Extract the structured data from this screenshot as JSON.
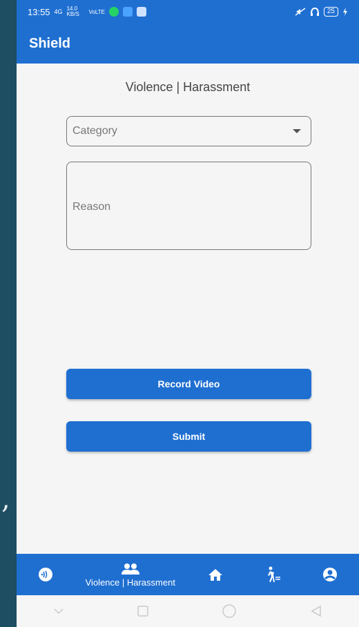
{
  "status_bar": {
    "time": "13:55",
    "signal": "4G",
    "speed": "14.0 KB/S",
    "volte": "VoLTE",
    "battery": "25"
  },
  "app_bar": {
    "title": "Shield"
  },
  "main": {
    "section_title": "Violence | Harassment",
    "category": {
      "placeholder": "Category"
    },
    "reason": {
      "placeholder": "Reason"
    },
    "record_button": "Record Video",
    "submit_button": "Submit"
  },
  "bottom_nav": {
    "items": [
      {
        "name": "nfc",
        "icon": "nfc-icon"
      },
      {
        "name": "violence-harassment",
        "icon": "people-icon",
        "label": "Violence | Harassment"
      },
      {
        "name": "home",
        "icon": "home-icon"
      },
      {
        "name": "walk",
        "icon": "walk-icon"
      },
      {
        "name": "profile",
        "icon": "account-circle-icon"
      }
    ]
  },
  "colors": {
    "primary": "#1f6fd1",
    "background": "#f5f5f5",
    "outer": "#1f4f63"
  }
}
